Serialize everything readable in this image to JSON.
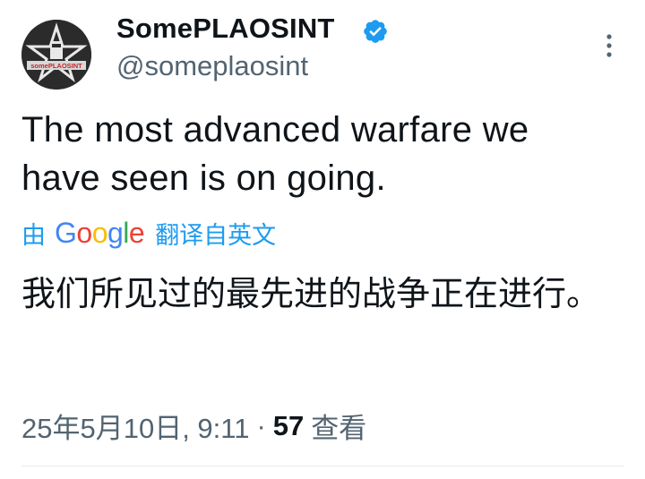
{
  "author": {
    "display_name": "SomePLAOSINT",
    "handle": "@someplaosint",
    "avatar_banner_text": "somePLAOSINT"
  },
  "tweet": {
    "text": "The most advanced warfare we have seen is on going."
  },
  "translation": {
    "by_label": "由",
    "provider": "Google",
    "action_label": "翻译自英文",
    "text": "我们所见过的最先进的战争正在进行。"
  },
  "meta": {
    "timestamp": "25年5月10日, 9:11",
    "separator": "·",
    "views_count": "57",
    "views_label": "查看"
  },
  "colors": {
    "accent": "#1d9bf0",
    "secondary_text": "#536471",
    "primary_text": "#0f1419"
  },
  "icons": {
    "verified": "verified-badge-icon",
    "more": "more-vertical-icon"
  }
}
